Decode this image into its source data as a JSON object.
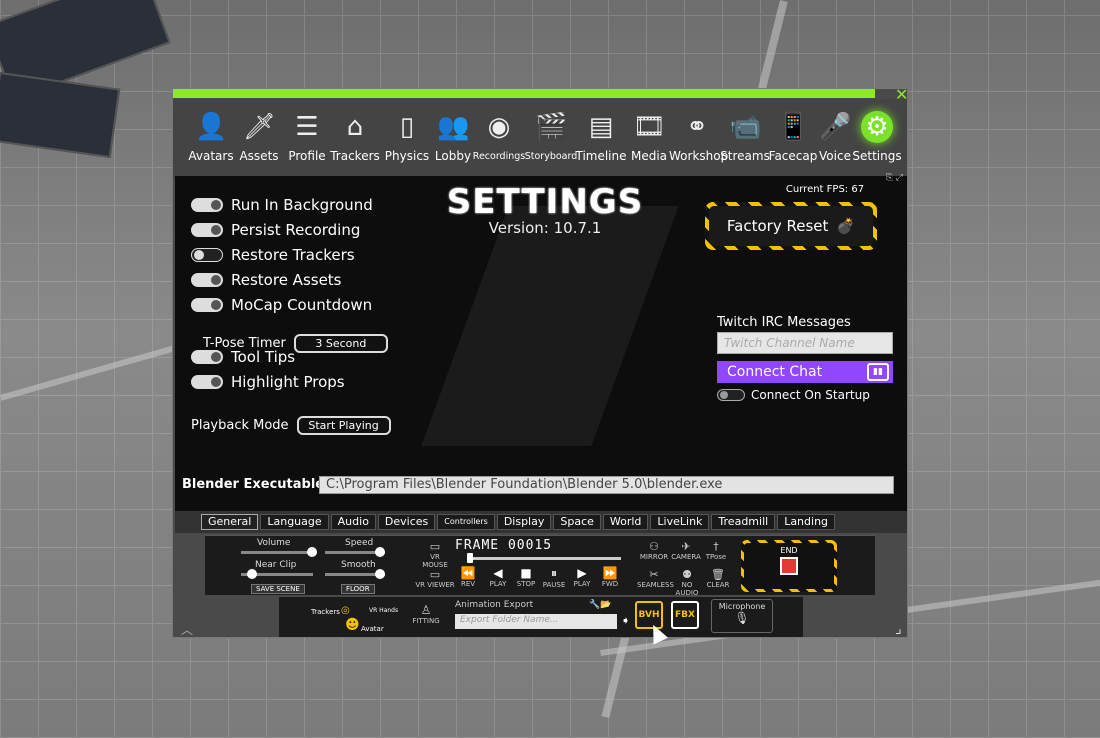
{
  "nav": {
    "items": [
      {
        "label": "Avatars",
        "icon": "person-icon",
        "glyph": "👤"
      },
      {
        "label": "Assets",
        "icon": "sword-icon",
        "glyph": "🗡"
      },
      {
        "label": "Profile",
        "icon": "sliders-icon",
        "glyph": "☰"
      },
      {
        "label": "Trackers",
        "icon": "tracker-icon",
        "glyph": "⌂"
      },
      {
        "label": "Physics",
        "icon": "door-icon",
        "glyph": "▯"
      },
      {
        "label": "Lobby",
        "icon": "group-icon",
        "glyph": "👥"
      },
      {
        "label": "Recordings",
        "icon": "film-reel-icon",
        "glyph": "◉"
      },
      {
        "label": "Storyboard",
        "icon": "clapperboard-icon",
        "glyph": "🎬"
      },
      {
        "label": "Timeline",
        "icon": "timeline-icon",
        "glyph": "▤"
      },
      {
        "label": "Media",
        "icon": "film-strip-icon",
        "glyph": "🎞"
      },
      {
        "label": "Workshop",
        "icon": "nodes-icon",
        "glyph": "⚭"
      },
      {
        "label": "Streams",
        "icon": "camera-icon",
        "glyph": "📹"
      },
      {
        "label": "Facecap",
        "icon": "phone-icon",
        "glyph": "📱"
      },
      {
        "label": "Voice",
        "icon": "microphone-icon",
        "glyph": "🎤"
      },
      {
        "label": "Settings",
        "icon": "gear-icon",
        "glyph": "⚙"
      }
    ]
  },
  "settings": {
    "title": "SETTINGS",
    "version": "Version: 10.7.1",
    "fps": "Current FPS: 67",
    "factory_reset": "Factory Reset",
    "toggles": [
      {
        "label": "Run In Background",
        "on": true
      },
      {
        "label": "Persist Recording",
        "on": true
      },
      {
        "label": "Restore Trackers",
        "on": false
      },
      {
        "label": "Restore Assets",
        "on": true
      },
      {
        "label": "MoCap Countdown",
        "on": true
      },
      {
        "label": "Tool Tips",
        "on": true
      },
      {
        "label": "Highlight Props",
        "on": true
      }
    ],
    "tpose_label": "T-Pose Timer",
    "tpose_value": "3 Second",
    "playback_label": "Playback Mode",
    "playback_value": "Start Playing",
    "twitch_label": "Twitch IRC Messages",
    "twitch_placeholder": "Twitch Channel Name",
    "connect_chat": "Connect Chat",
    "connect_startup": "Connect On Startup",
    "blender_label": "Blender Executable:",
    "blender_path": "C:\\Program Files\\Blender Foundation\\Blender 5.0\\blender.exe"
  },
  "tabs": [
    "General",
    "Language",
    "Audio",
    "Devices",
    "Controllers",
    "Display",
    "Space",
    "World",
    "LiveLink",
    "Treadmill",
    "Landing"
  ],
  "dock": {
    "volume": "Volume",
    "speed": "Speed",
    "near_clip": "Near Clip",
    "smooth": "Smooth",
    "save_scene": "SAVE SCENE",
    "floor": "FLOOR",
    "vr_mouse": "VR MOUSE",
    "vr_viewer": "VR VIEWER",
    "frame": "FRAME  00015",
    "rev": "REV",
    "play_back": "PLAY",
    "stop": "STOP",
    "pause": "PAUSE",
    "play": "PLAY",
    "fwd": "FWD",
    "mirror": "MIRROR",
    "camera": "CAMERA",
    "tpose": "TPose",
    "seamless": "SEAMLESS",
    "no_audio": "NO AUDIO",
    "clear": "CLEAR",
    "end": "END",
    "trackers": "Trackers",
    "vr_hands": "VR Hands",
    "avatar": "Avatar",
    "fitting": "FITTING",
    "anim_export": "Animation Export",
    "export_placeholder": "Export Folder Name...",
    "bvh": "BVH",
    "fbx": "FBX",
    "microphone": "Microphone"
  }
}
